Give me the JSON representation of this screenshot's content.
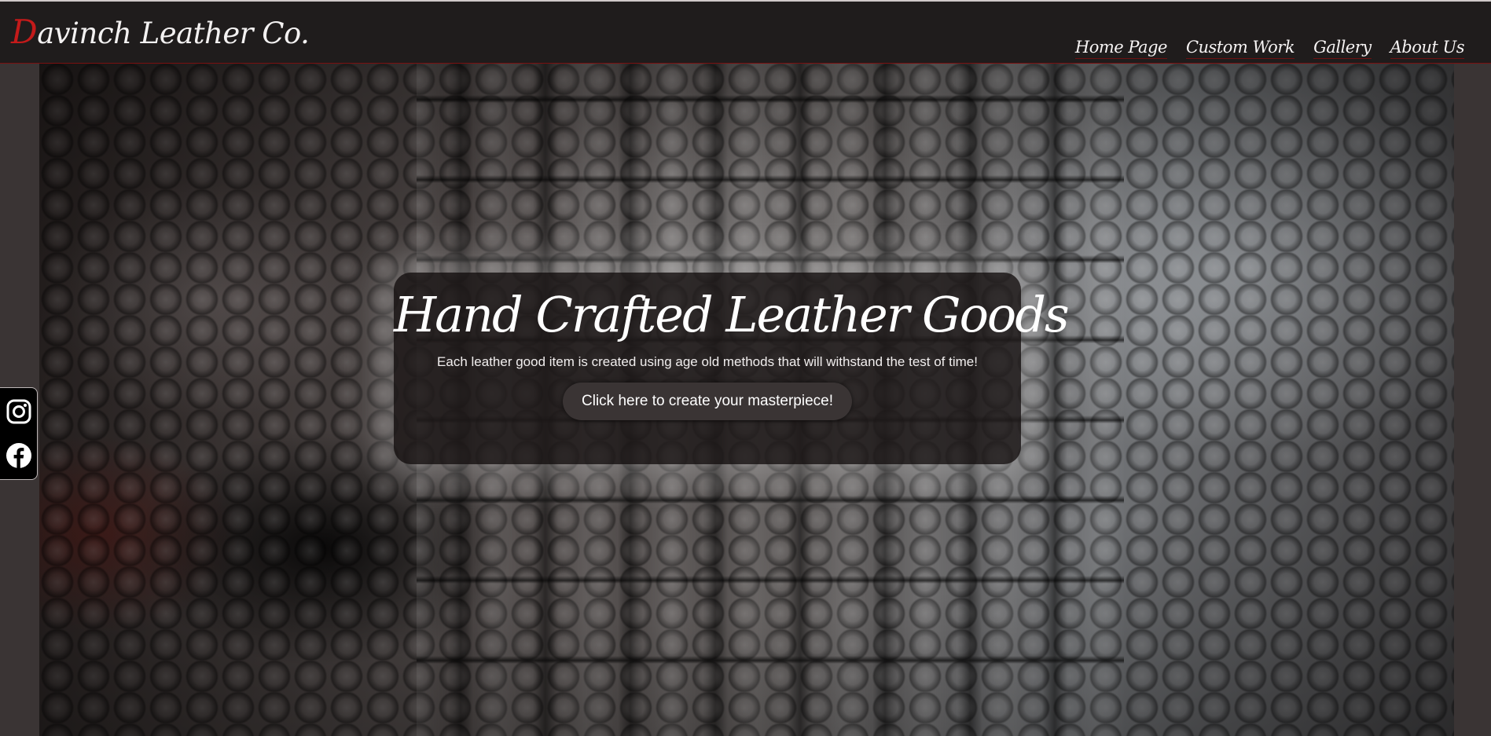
{
  "header": {
    "logo_initial": "D",
    "logo_rest": "avinch Leather Co.",
    "nav": [
      {
        "label": "Home Page"
      },
      {
        "label": "Custom Work"
      },
      {
        "label": "Gallery"
      },
      {
        "label": "About Us"
      }
    ]
  },
  "hero": {
    "background": "crocodile leather texture"
  },
  "card": {
    "title": "Hand Crafted Leather Goods",
    "subtitle": "Each leather good item is created using age old methods that will withstand the test of time!",
    "cta_label": "Click here to create your masterpiece!"
  },
  "social": {
    "icons": [
      "instagram-icon",
      "facebook-icon"
    ]
  },
  "colors": {
    "header_bg": "#1f1c1c",
    "accent_red": "#c41a1a",
    "page_bg": "#3a3434",
    "card_bg": "#1e1a1a"
  }
}
